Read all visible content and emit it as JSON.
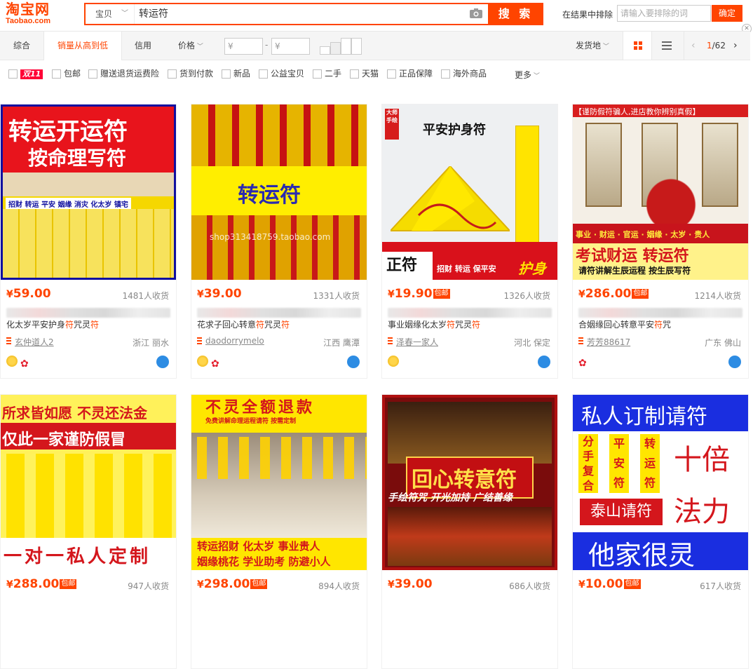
{
  "header": {
    "logo_main": "淘宝网",
    "logo_sub": "Taobao.com",
    "search_type": "宝贝",
    "search_query": "转运符",
    "search_button": "搜 索",
    "exclude_label": "在结果中排除",
    "exclude_placeholder": "请输入要排除的词",
    "exclude_button": "确定"
  },
  "sortbar": {
    "items": [
      "综合",
      "销量从高到低",
      "信用",
      "价格"
    ],
    "price_from": "¥",
    "price_to": "¥",
    "ship_from": "发货地",
    "page": "1",
    "total_pages": "/62"
  },
  "filters": {
    "double11": "双11",
    "items": [
      "包邮",
      "赠送退货运费险",
      "货到付款",
      "新品",
      "公益宝贝",
      "二手",
      "天猫",
      "正品保障",
      "海外商品"
    ],
    "more": "更多"
  },
  "products": [
    {
      "price": "59.00",
      "free_ship": "",
      "sales": "1481人收货",
      "title_pre": "化太岁平安护身",
      "title_hl": "符",
      "title_mid": "咒灵",
      "title_hl2": "符",
      "title_post": "",
      "shop": "玄仲道人2",
      "location": "浙江 丽水",
      "pic": {
        "line1": "转运开运符",
        "line2": "按命理写符",
        "strip": "招财 转运 平安 姻缘 消灾 化太岁 镇宅"
      }
    },
    {
      "price": "39.00",
      "free_ship": "",
      "sales": "1331人收货",
      "title_pre": "花求子回心转意",
      "title_hl": "符",
      "title_mid": "咒灵",
      "title_hl2": "符",
      "title_post": "",
      "shop": "daodorrymelo",
      "location": "江西 鹰潭",
      "pic": {
        "line1": "转运符",
        "watermark": "shop313418759.taobao.com"
      }
    },
    {
      "price": "19.90",
      "free_ship": "包邮",
      "sales": "1326人收货",
      "title_pre": "事业姻缘化太岁",
      "title_hl": "符",
      "title_mid": "咒灵",
      "title_hl2": "符",
      "title_post": "",
      "shop": "泽春一家人",
      "location": "河北 保定",
      "pic": {
        "line1": "平安护身符",
        "seal": "大师手绘",
        "line2": "正符",
        "strip": "招财 转运 保平安",
        "big": "护身"
      }
    },
    {
      "price": "286.00",
      "free_ship": "包邮",
      "sales": "1214人收货",
      "title_pre": "合姻缘回心转意平安",
      "title_hl": "符",
      "title_mid": "咒",
      "title_hl2": "",
      "title_post": "",
      "shop": "芳芳88617",
      "location": "广东 佛山",
      "pic": {
        "banner": "【谨防假符骗人,进店教你辨别真假】",
        "strip": "事业 · 财运 · 官运 · 姻缘 · 太岁 · 贵人",
        "line1": "考试财运 转运符",
        "line2": "请符讲解生辰运程 按生辰写符"
      }
    },
    {
      "price": "288.00",
      "free_ship": "包邮",
      "sales": "947人收货",
      "pic": {
        "line1": "所求皆如愿 不灵还法金",
        "line2": "仅此一家谨防假冒",
        "line3": "一对一私人定制"
      }
    },
    {
      "price": "298.00",
      "free_ship": "包邮",
      "sales": "894人收货",
      "pic": {
        "line1": "不灵全额退款",
        "strip": "免费讲解命理运程请符 按需定制",
        "line2": "转运招财  化太岁  事业贵人",
        "line3": "姻缘桃花  学业助考  防避小人"
      }
    },
    {
      "price": "39.00",
      "free_ship": "",
      "sales": "686人收货",
      "pic": {
        "line1": "回心转意符",
        "line2": "手绘符咒 开光加持 广结善缘"
      }
    },
    {
      "price": "10.00",
      "free_ship": "包邮",
      "sales": "617人收货",
      "pic": {
        "line1": "私人订制请符",
        "c1": "分手复合",
        "c2": "平安符",
        "c3": "转运符",
        "big1": "十倍",
        "big2": "法力",
        "red": "泰山请符",
        "line3": "他家很灵"
      }
    }
  ],
  "colors": {
    "accent": "#ff4400",
    "tmall_red": "#ff0036",
    "wangwang": "#2d8ce3"
  }
}
